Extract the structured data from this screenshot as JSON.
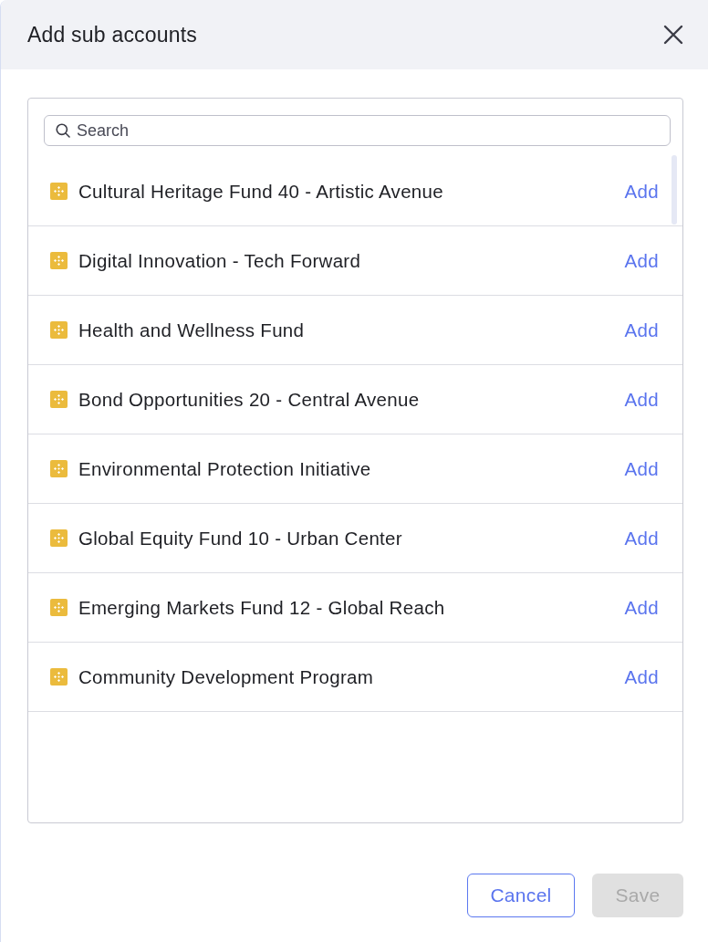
{
  "dialog": {
    "title": "Add sub accounts"
  },
  "search": {
    "placeholder": "Search"
  },
  "accounts": [
    {
      "name": "Cultural Heritage Fund 40 - Artistic Avenue",
      "action": "Add"
    },
    {
      "name": "Digital Innovation - Tech Forward",
      "action": "Add"
    },
    {
      "name": "Health and Wellness Fund",
      "action": "Add"
    },
    {
      "name": "Bond Opportunities 20 - Central Avenue",
      "action": "Add"
    },
    {
      "name": "Environmental Protection Initiative",
      "action": "Add"
    },
    {
      "name": "Global Equity Fund 10 - Urban Center",
      "action": "Add"
    },
    {
      "name": "Emerging Markets Fund 12 - Global Reach",
      "action": "Add"
    },
    {
      "name": "Community Development Program",
      "action": "Add"
    }
  ],
  "buttons": [
    {
      "label": "Cancel",
      "kind": "secondary",
      "disabled": false
    },
    {
      "label": "Save",
      "kind": "primary",
      "disabled": true
    }
  ]
}
